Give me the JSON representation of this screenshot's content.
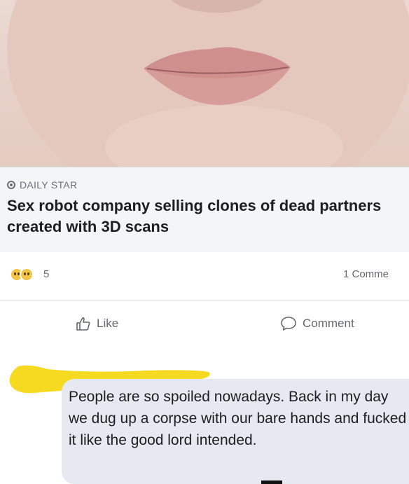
{
  "post": {
    "image": {
      "subject": "close-up of lips and chin"
    },
    "link": {
      "source": "DAILY STAR",
      "headline": "Sex robot company selling clones of dead partners created with 3D scans"
    },
    "reactions": {
      "count": "5",
      "comments": "1 Comme"
    },
    "actions": {
      "like": "Like",
      "comment": "Comment"
    },
    "comment": {
      "text": "People are so spoiled nowadays. Back in my day we dug up a corpse with our bare hands and fucked it like the good lord intended."
    }
  },
  "colors": {
    "highlighter": "#f6d921",
    "skin": "#e4c9bd",
    "lips": "#c98886",
    "bubble": "#e6e9ef"
  }
}
